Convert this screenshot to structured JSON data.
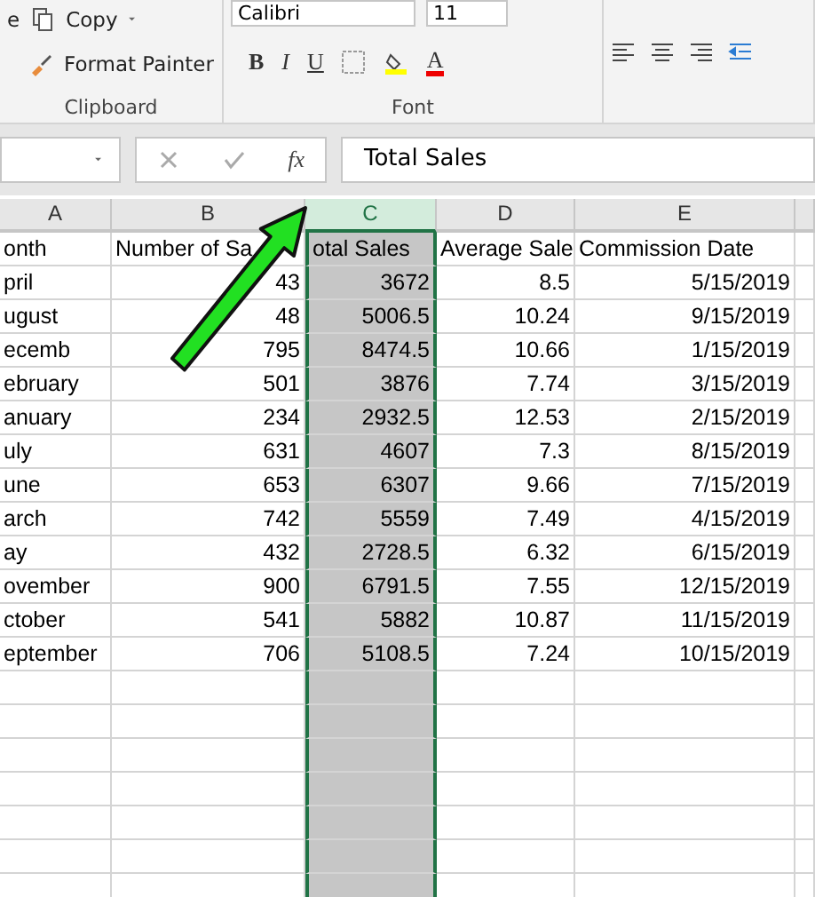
{
  "ribbon": {
    "clipboard": {
      "paste_label": "e",
      "copy": "Copy",
      "format_painter": "Format Painter",
      "title": "Clipboard"
    },
    "font": {
      "font_name": "Calibri",
      "font_size": "11",
      "bold": "B",
      "italic": "I",
      "underline": "U",
      "font_color": "A",
      "title": "Font"
    }
  },
  "formula_bar": {
    "fx": "fx",
    "formula": "Total Sales"
  },
  "sheet": {
    "columns": [
      {
        "letter": "A",
        "selected": false
      },
      {
        "letter": "B",
        "selected": false
      },
      {
        "letter": "C",
        "selected": true
      },
      {
        "letter": "D",
        "selected": false
      },
      {
        "letter": "E",
        "selected": false
      }
    ],
    "rows": [
      [
        "onth",
        "Number of Sa",
        "otal Sales",
        "Average Sale",
        "Commission Date"
      ],
      [
        "pril",
        "43",
        "3672",
        "8.5",
        "5/15/2019"
      ],
      [
        "ugust",
        "48",
        "5006.5",
        "10.24",
        "9/15/2019"
      ],
      [
        "ecemb",
        "795",
        "8474.5",
        "10.66",
        "1/15/2019"
      ],
      [
        "ebruary",
        "501",
        "3876",
        "7.74",
        "3/15/2019"
      ],
      [
        "anuary",
        "234",
        "2932.5",
        "12.53",
        "2/15/2019"
      ],
      [
        "uly",
        "631",
        "4607",
        "7.3",
        "8/15/2019"
      ],
      [
        "une",
        "653",
        "6307",
        "9.66",
        "7/15/2019"
      ],
      [
        "arch",
        "742",
        "5559",
        "7.49",
        "4/15/2019"
      ],
      [
        "ay",
        "432",
        "2728.5",
        "6.32",
        "6/15/2019"
      ],
      [
        "ovember",
        "900",
        "6791.5",
        "7.55",
        "12/15/2019"
      ],
      [
        "ctober",
        "541",
        "5882",
        "10.87",
        "11/15/2019"
      ],
      [
        "eptember",
        "706",
        "5108.5",
        "7.24",
        "10/15/2019"
      ]
    ]
  }
}
